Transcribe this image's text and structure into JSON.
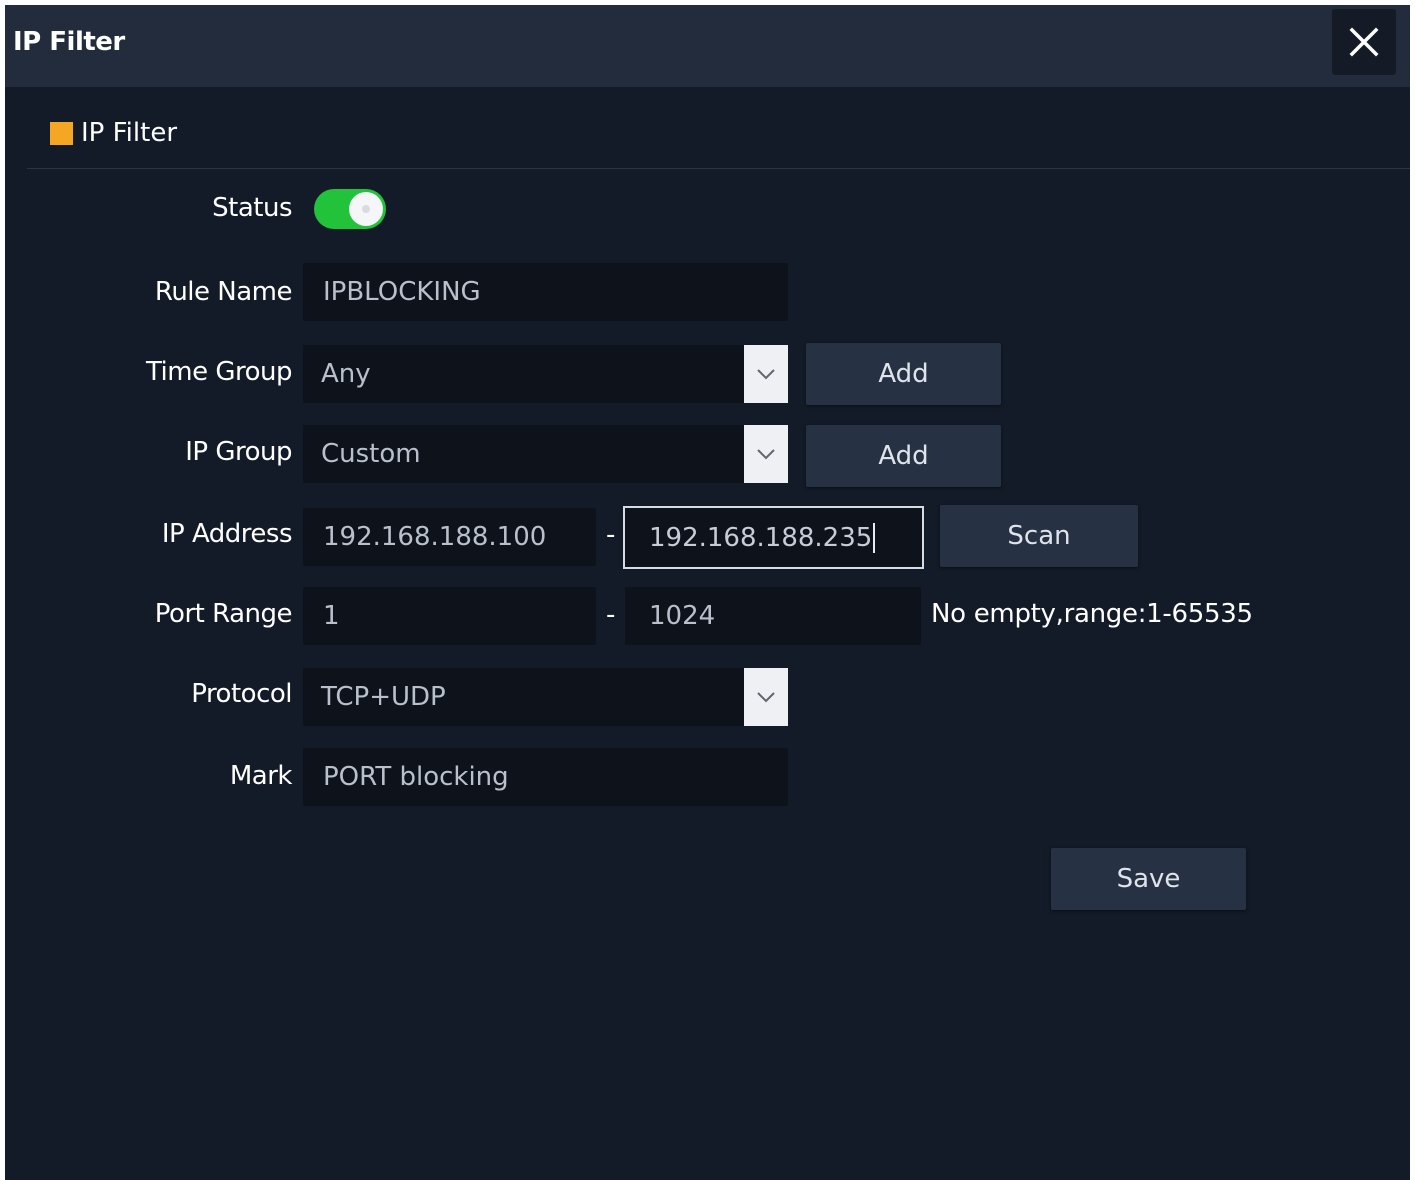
{
  "window": {
    "title": "IP Filter",
    "close_icon": "close-icon"
  },
  "section": {
    "title": "IP Filter",
    "marker_color": "#f5a623"
  },
  "form": {
    "status": {
      "label": "Status",
      "enabled": true,
      "color": "#22c23a"
    },
    "rule_name": {
      "label": "Rule Name",
      "value": "IPBLOCKING"
    },
    "time_group": {
      "label": "Time Group",
      "selected": "Any",
      "add_label": "Add"
    },
    "ip_group": {
      "label": "IP Group",
      "selected": "Custom",
      "add_label": "Add"
    },
    "ip_address": {
      "label": "IP Address",
      "start": "192.168.188.100",
      "separator": "-",
      "end": "192.168.188.235",
      "scan_label": "Scan"
    },
    "port_range": {
      "label": "Port Range",
      "start": "1",
      "separator": "-",
      "end": "1024",
      "hint": "No empty,range:1-65535"
    },
    "protocol": {
      "label": "Protocol",
      "selected": "TCP+UDP"
    },
    "mark": {
      "label": "Mark",
      "value": "PORT blocking"
    }
  },
  "actions": {
    "save_label": "Save"
  }
}
